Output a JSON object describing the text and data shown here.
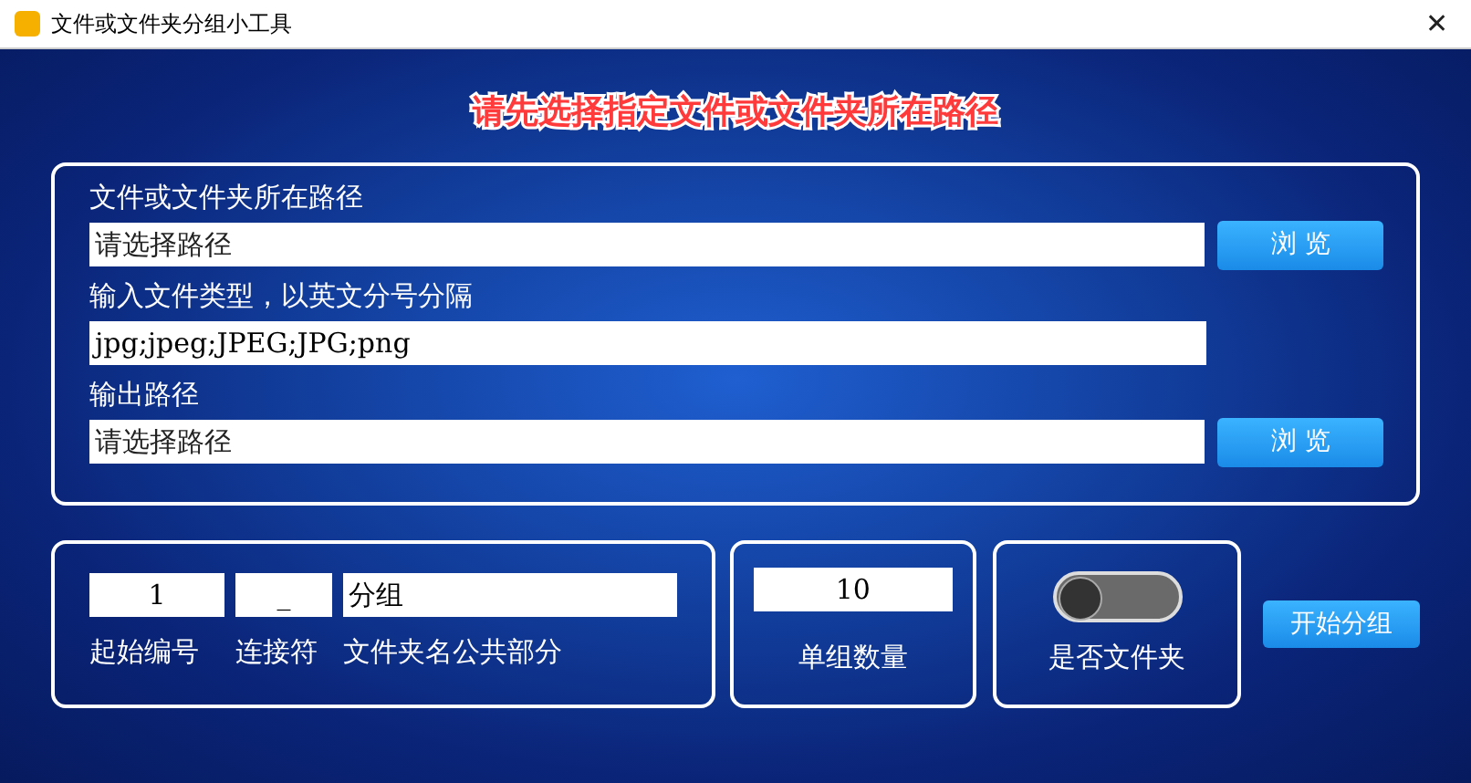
{
  "window": {
    "title": "文件或文件夹分组小工具",
    "close": "✕"
  },
  "heading": "请先选择指定文件或文件夹所在路径",
  "path_panel": {
    "fields": [
      {
        "label": "文件或文件夹所在路径",
        "placeholder": "请选择路径",
        "button": "浏 览"
      },
      {
        "label": "输入文件类型，以英文分号分隔",
        "value": "jpg;jpeg;JPEG;JPG;png"
      },
      {
        "label": "输出路径",
        "placeholder": "请选择路径",
        "button": "浏 览"
      }
    ]
  },
  "naming": {
    "fields": [
      {
        "value": "1",
        "label": "起始编号"
      },
      {
        "value": "_",
        "label": "连接符"
      },
      {
        "value": "分组",
        "label": "文件夹名公共部分"
      }
    ]
  },
  "group_size": {
    "value": "10",
    "label": "单组数量"
  },
  "folder_toggle": {
    "on": false,
    "label": "是否文件夹"
  },
  "start_button": "开始分组"
}
